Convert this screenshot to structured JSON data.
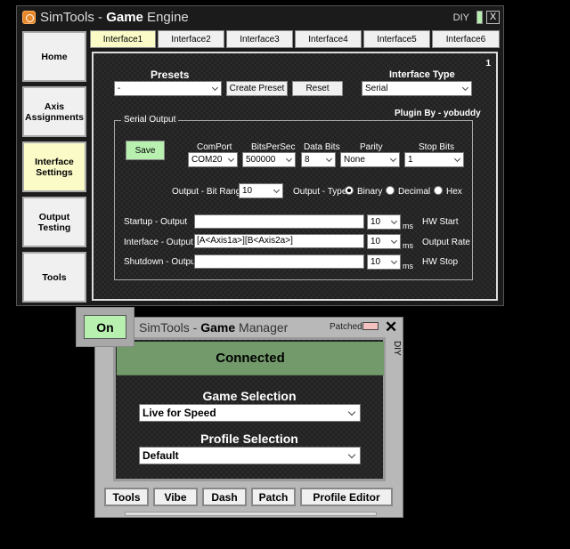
{
  "engine": {
    "title_prefix": "SimTools - ",
    "title_bold": "Game",
    "title_suffix": " Engine",
    "diy_label": "DIY",
    "close_glyph": "X",
    "sidebar": [
      {
        "label": "Home"
      },
      {
        "label": "Axis Assignments"
      },
      {
        "label": "Interface Settings"
      },
      {
        "label": "Output Testing"
      },
      {
        "label": "Tools"
      }
    ],
    "tabs": [
      {
        "label": "Interface1"
      },
      {
        "label": "Interface2"
      },
      {
        "label": "Interface3"
      },
      {
        "label": "Interface4"
      },
      {
        "label": "Interface5"
      },
      {
        "label": "Interface6"
      }
    ],
    "panel_number": "1",
    "presets_label": "Presets",
    "presets_value": "-",
    "create_preset": "Create Preset",
    "reset": "Reset",
    "interface_type_label": "Interface Type",
    "interface_type_value": "Serial",
    "plugin_by": "Plugin By - yobuddy",
    "serial_output_label": "Serial Output",
    "save": "Save",
    "comport_label": "ComPort",
    "comport_value": "COM20",
    "bits_per_sec_label": "BitsPerSec",
    "bits_per_sec_value": "500000",
    "data_bits_label": "Data Bits",
    "data_bits_value": "8",
    "parity_label": "Parity",
    "parity_value": "None",
    "stop_bits_label": "Stop Bits",
    "stop_bits_value": "1",
    "bit_range_label": "Output - Bit Range",
    "bit_range_value": "10",
    "output_type_label": "Output - Type",
    "output_types": [
      "Binary",
      "Decimal",
      "Hex"
    ],
    "startup_label": "Startup - Output",
    "startup_value": "",
    "startup_ms": "10",
    "startup_right": "HW Start",
    "interface_label": "Interface - Output",
    "interface_value": "[A<Axis1a>][B<Axis2a>]",
    "interface_ms": "10",
    "interface_right": "Output Rate",
    "shutdown_label": "Shutdown - Output",
    "shutdown_value": "",
    "shutdown_ms": "10",
    "shutdown_right": "HW Stop",
    "ms_label": "ms"
  },
  "manager": {
    "on_label": "On",
    "title_prefix": "SimTools - ",
    "title_bold": "Game",
    "title_suffix": " Manager",
    "patched_label": "Patched",
    "close_glyph": "✕",
    "diy_label": "DIY",
    "status": "Connected",
    "game_selection_label": "Game Selection",
    "game_selection_value": "Live for Speed",
    "profile_selection_label": "Profile Selection",
    "profile_selection_value": "Default",
    "buttons": [
      {
        "label": "Tools"
      },
      {
        "label": "Vibe"
      },
      {
        "label": "Dash"
      },
      {
        "label": "Patch"
      },
      {
        "label": "Profile Editor"
      }
    ]
  },
  "colors": {
    "active_button": "#fbfbc8",
    "green_button": "#b8f0b0",
    "connected_bar": "#729a6a",
    "patched_indicator": "#f5c0c0"
  }
}
